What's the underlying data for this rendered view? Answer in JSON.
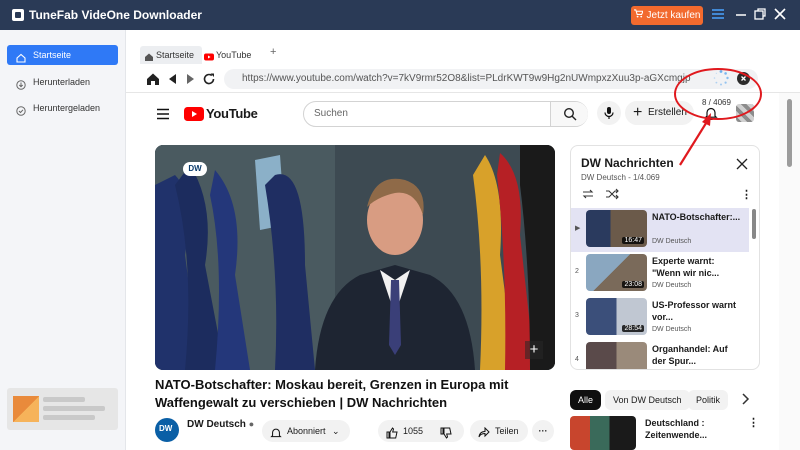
{
  "app": {
    "title": "TuneFab VideOne Downloader",
    "buy_button": "Jetzt kaufen",
    "accent_color": "#f26a2e",
    "titlebar_color": "#2a3a56"
  },
  "sidebar": {
    "items": [
      {
        "label": "Startseite",
        "icon": "home-icon",
        "active": true
      },
      {
        "label": "Herunterladen",
        "icon": "download-icon",
        "active": false
      },
      {
        "label": "Heruntergeladen",
        "icon": "check-circle-icon",
        "active": false
      }
    ]
  },
  "browser": {
    "tabs": [
      {
        "label": "Startseite",
        "icon": "home-icon"
      },
      {
        "label": "YouTube",
        "icon": "youtube-icon"
      }
    ],
    "new_tab": "+",
    "url": "https://www.youtube.com/watch?v=7kV9rmr52O8&list=PLdrKWT9w9Hg2nUWmpxzXuu3p-aGXcmgjp",
    "download_counter": "8 / 4069"
  },
  "youtube": {
    "logo_text": "YouTube",
    "search_placeholder": "Suchen",
    "create_label": "Erstellen",
    "video": {
      "badge": "DW",
      "title": "NATO-Botschafter: Moskau bereit, Grenzen in Europa mit Waffengewalt zu verschieben | DW Nachrichten",
      "channel": "DW Deutsch",
      "subscribe_label": "Abonniert",
      "likes": "1055",
      "share_label": "Teilen"
    },
    "playlist": {
      "title": "DW Nachrichten",
      "subtitle": "DW Deutsch - 1/4.069",
      "items": [
        {
          "index": "▶",
          "title": "NATO-Botschafter:...",
          "channel": "DW Deutsch",
          "duration": "16:47",
          "active": true
        },
        {
          "index": "2",
          "title": "Experte warnt: \"Wenn wir nic...",
          "channel": "DW Deutsch",
          "duration": "23:08",
          "active": false
        },
        {
          "index": "3",
          "title": "US-Professor warnt vor...",
          "channel": "DW Deutsch",
          "duration": "28:54",
          "active": false
        },
        {
          "index": "4",
          "title": "Organhandel: Auf der Spur...",
          "channel": "DW Deutsch",
          "duration": "",
          "active": false
        }
      ]
    },
    "chips": [
      "Alle",
      "Von DW Deutsch",
      "Politik"
    ],
    "next_suggestion": {
      "title": "Deutschland : Zeitenwende..."
    }
  }
}
